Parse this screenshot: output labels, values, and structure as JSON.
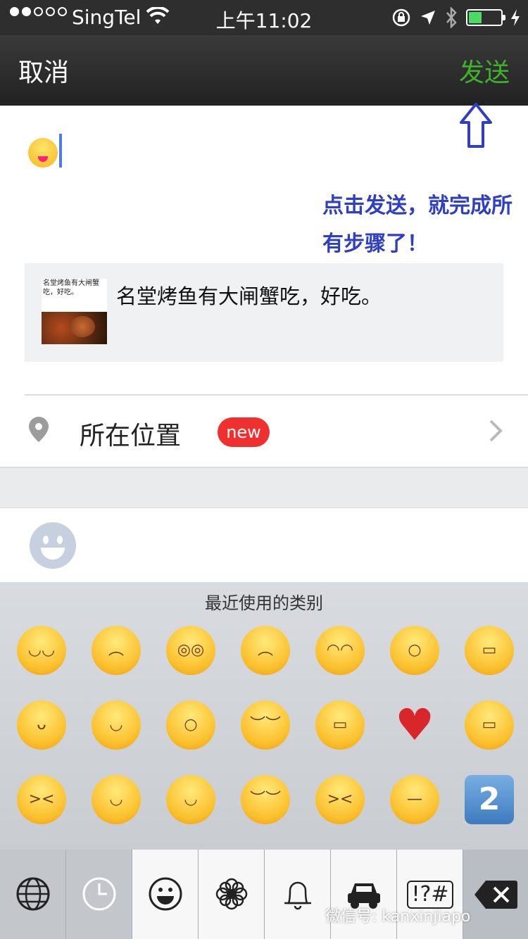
{
  "status_bar": {
    "carrier": "SingTel",
    "time": "上午11:02",
    "battery_level": 0.4
  },
  "nav": {
    "cancel_label": "取消",
    "send_label": "发送",
    "send_color": "#3fb22a"
  },
  "annotation": {
    "line1": "点击发送，就完成所",
    "line2": "有步骤了！",
    "color": "#2f3fc4"
  },
  "share_card": {
    "thumb_title": "名堂烤鱼有大闸蟹吃，好吃。",
    "text": "名堂烤鱼有大闸蟹吃，好吃。"
  },
  "location": {
    "label": "所在位置",
    "badge": "new"
  },
  "keyboard": {
    "category_title": "最近使用的类别",
    "emojis": [
      "joy-icon",
      "disappointed-relieved-icon",
      "flushed-icon",
      "cry-icon",
      "sweat-smile-icon",
      "sob-icon",
      "grimacing-icon",
      "tongue-icon",
      "relaxed-icon",
      "scream-icon",
      "sleepy-icon",
      "mask-icon",
      "broken-heart-icon",
      "grimace-icon",
      "laughing-icon",
      "wink-icon",
      "yum-icon",
      "sleeping-icon",
      "persevere-icon",
      "unamused-icon",
      "keycap-two-icon"
    ],
    "tabs": [
      "globe-icon",
      "recent-clock-icon",
      "smiley-icon",
      "flower-icon",
      "bell-icon",
      "car-icon",
      "symbols-icon",
      "delete-icon"
    ],
    "symbols_tab_label": "!?#"
  },
  "watermark": "微信号: kanxinjiapo"
}
